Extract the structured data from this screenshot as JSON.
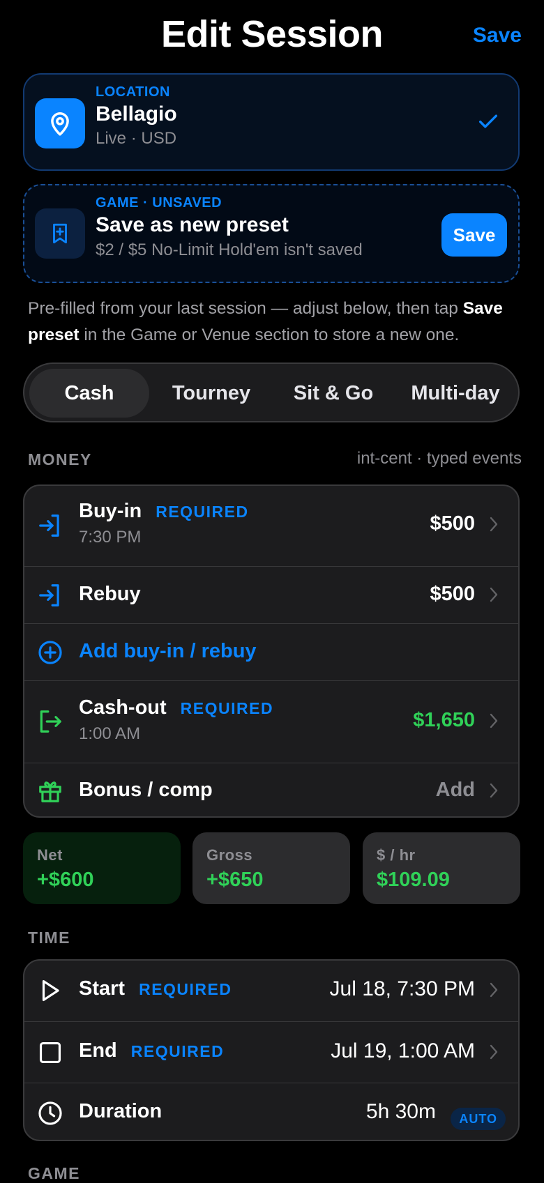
{
  "header": {
    "title": "Edit Session",
    "save_label": "Save"
  },
  "location": {
    "kicker": "LOCATION",
    "name": "Bellagio",
    "detail": "Live · USD"
  },
  "game": {
    "kicker": "GAME · UNSAVED",
    "title": "Save as new preset",
    "detail": "$2 / $5 No-Limit Hold'em isn't saved",
    "save_label": "Save"
  },
  "hint": {
    "part1": "Pre-filled from your last session — adjust below, then tap ",
    "bold1": "Save preset",
    "part2": " in the Game or Venue section to store a new one."
  },
  "tabs": [
    {
      "label": "Cash",
      "active": true
    },
    {
      "label": "Tourney"
    },
    {
      "label": "Sit & Go"
    },
    {
      "label": "Multi-day"
    }
  ],
  "money": {
    "section_label": "MONEY",
    "meta": "int-cent · typed events",
    "buyin": {
      "label": "Buy-in",
      "required": "REQUIRED",
      "time": "7:30 PM",
      "value": "$500"
    },
    "rebuy": {
      "label": "Rebuy",
      "value": "$500"
    },
    "add_buyin": {
      "label": "Add buy-in / rebuy"
    },
    "cashout": {
      "label": "Cash-out",
      "required": "REQUIRED",
      "time": "1:00 AM",
      "value": "$1,650"
    },
    "bonus": {
      "label": "Bonus / comp",
      "value": "Add"
    }
  },
  "stats": [
    {
      "label": "Net",
      "value": "+$600"
    },
    {
      "label": "Gross",
      "value": "+$650"
    },
    {
      "label": "$ / hr",
      "value": "$109.09"
    }
  ],
  "time": {
    "section_label": "TIME",
    "start": {
      "label": "Start",
      "required": "REQUIRED",
      "value": "Jul 18, 7:30 PM"
    },
    "end": {
      "label": "End",
      "required": "REQUIRED",
      "value": "Jul 19, 1:00 AM"
    },
    "duration": {
      "label": "Duration",
      "value": "5h 30m",
      "badge": "AUTO"
    }
  },
  "next_section_label": "GAME",
  "colors": {
    "accent": "#0a84ff",
    "positive": "#30d158",
    "background": "#000000",
    "card": "#1c1c1e"
  },
  "icons": [
    "location-pin-icon",
    "checkmark-icon",
    "bookmark-plus-icon",
    "sign-in-icon",
    "plus-circle-icon",
    "sign-out-icon",
    "gift-icon",
    "chevron-right-icon",
    "play-icon",
    "stop-square-icon",
    "clock-icon"
  ]
}
